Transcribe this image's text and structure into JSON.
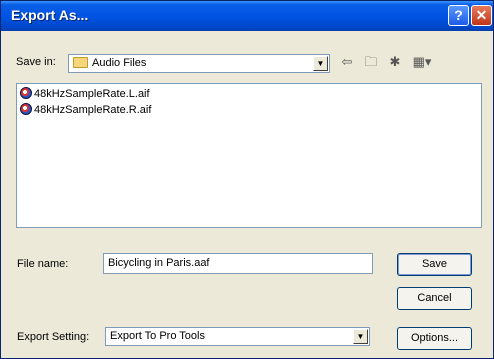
{
  "window": {
    "title": "Export As..."
  },
  "save_in": {
    "label": "Save in:",
    "value": "Audio Files"
  },
  "toolbar": {
    "back_icon": "back-arrow-icon",
    "up_icon": "up-folder-icon",
    "new_folder_icon": "new-folder-icon",
    "view_icon": "view-menu-icon"
  },
  "files": [
    {
      "name": "48kHzSampleRate.L.aif"
    },
    {
      "name": "48kHzSampleRate.R.aif"
    }
  ],
  "file_name": {
    "label": "File name:",
    "value": "Bicycling in Paris.aaf"
  },
  "export_setting": {
    "label": "Export Setting:",
    "value": "Export To Pro Tools"
  },
  "buttons": {
    "save": "Save",
    "cancel": "Cancel",
    "options": "Options..."
  },
  "colors": {
    "title_bar": "#0054e3",
    "dialog_bg": "#ece9d8"
  }
}
